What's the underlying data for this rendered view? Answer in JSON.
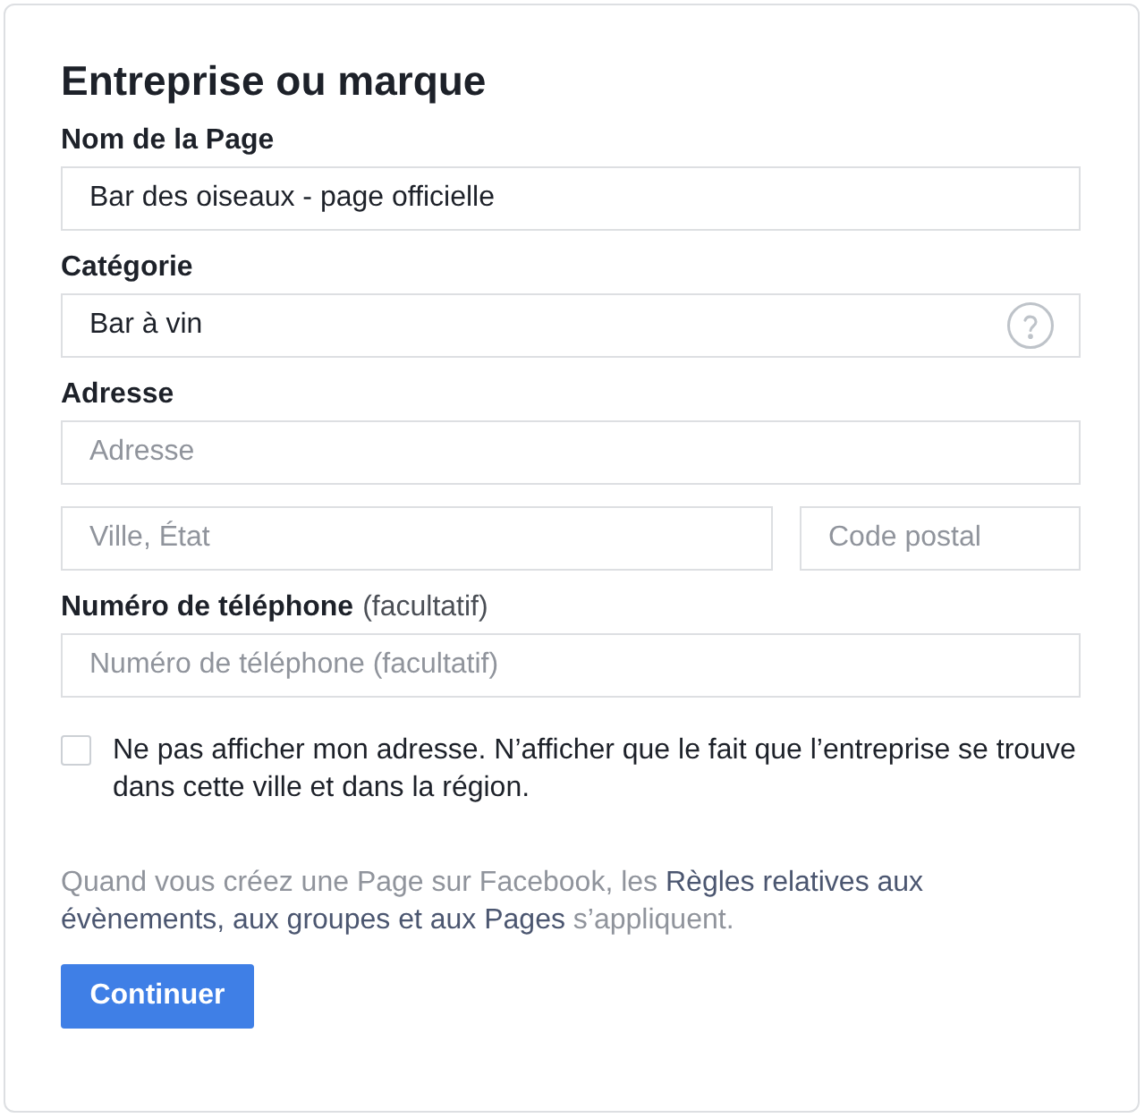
{
  "form": {
    "title": "Entreprise ou marque",
    "sections": [
      {
        "label": "Nom de la Page",
        "rows": [
          [
            {
              "kind": "plain",
              "value": "Bar des oiseaux - page officielle"
            }
          ]
        ]
      },
      {
        "label": "Catégorie",
        "rows": [
          [
            {
              "kind": "help",
              "value": "Bar à vin"
            }
          ]
        ]
      },
      {
        "label": "Adresse",
        "rows": [
          [
            {
              "kind": "plain",
              "placeholder": "Adresse"
            }
          ],
          [
            {
              "kind": "plain",
              "placeholder": "Ville, État"
            },
            {
              "kind": "plain",
              "placeholder": "Code postal"
            }
          ]
        ]
      },
      {
        "label": "Numéro de téléphone",
        "note": "(facultatif)",
        "rows": [
          [
            {
              "kind": "plain",
              "placeholder": "Numéro de téléphone (facultatif)"
            }
          ]
        ]
      }
    ],
    "hide_address": {
      "checked": false,
      "label": "Ne pas afficher mon adresse. N’afficher que le fait que l’entreprise se trouve dans cette ville et dans la région."
    },
    "legal_notice": {
      "lines": [
        [
          {
            "kind": "text",
            "text": "Quand vous créez une Page sur Facebook, les"
          },
          {
            "kind": "link",
            "text": "Règles relatives aux"
          }
        ],
        [
          {
            "kind": "link",
            "text": "évènements, aux groupes et aux Pages"
          },
          {
            "kind": "text",
            "text": "s’appliquent."
          }
        ]
      ]
    },
    "submit": {
      "label": "Continuer"
    }
  }
}
